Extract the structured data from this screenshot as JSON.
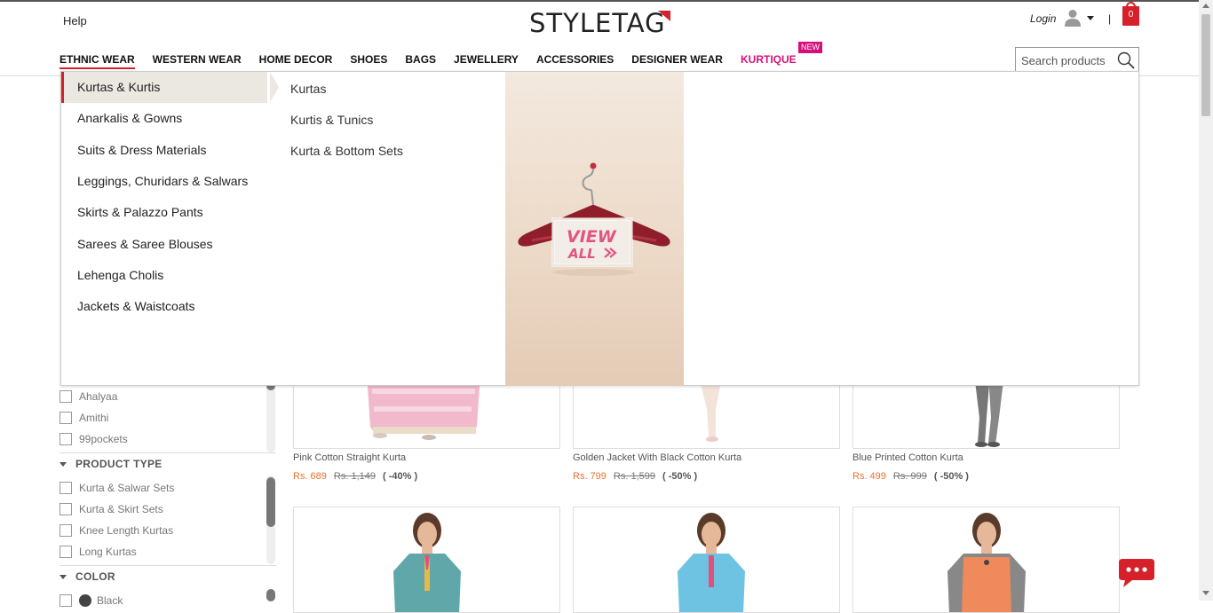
{
  "header": {
    "help": "Help",
    "logo": "STYLETAG",
    "login": "Login",
    "pipe": "|",
    "cart_count": "0",
    "search_placeholder": "Search products"
  },
  "nav": {
    "items": [
      {
        "label": "ETHNIC WEAR"
      },
      {
        "label": "WESTERN WEAR"
      },
      {
        "label": "HOME DECOR"
      },
      {
        "label": "SHOES"
      },
      {
        "label": "BAGS"
      },
      {
        "label": "JEWELLERY"
      },
      {
        "label": "ACCESSORIES"
      },
      {
        "label": "DESIGNER WEAR"
      },
      {
        "label": "KURTIQUE"
      }
    ],
    "new_badge": "NEW"
  },
  "mega_menu": {
    "categories": [
      "Kurtas & Kurtis",
      "Anarkalis & Gowns",
      "Suits & Dress Materials",
      "Leggings, Churidars & Salwars",
      "Skirts & Palazzo Pants",
      "Sarees & Saree Blouses",
      "Lehenga Cholis",
      "Jackets & Waistcoats"
    ],
    "subcategories": [
      "Kurtas",
      "Kurtis & Tunics",
      "Kurta & Bottom Sets"
    ],
    "promo_line1": "VIEW",
    "promo_line2": "ALL"
  },
  "filters": {
    "brands": [
      "Ahalyaa",
      "Amithi",
      "99pockets"
    ],
    "product_type_title": "PRODUCT TYPE",
    "product_types": [
      "Kurta & Salwar Sets",
      "Kurta & Skirt Sets",
      "Knee Length Kurtas",
      "Long Kurtas"
    ],
    "color_title": "COLOR",
    "colors": [
      "Black"
    ]
  },
  "products": [
    {
      "name": "Pink Cotton Straight Kurta",
      "price": "Rs. 689",
      "mrp": "Rs. 1,149",
      "discount": "( -40% )"
    },
    {
      "name": "Golden Jacket With Black Cotton Kurta",
      "price": "Rs. 799",
      "mrp": "Rs. 1,599",
      "discount": "( -50% )"
    },
    {
      "name": "Blue Printed Cotton Kurta",
      "price": "Rs. 499",
      "mrp": "Rs. 999",
      "discount": "( -50% )"
    }
  ],
  "colors": {
    "accent_red": "#d6202a",
    "kurtique_pink": "#d6107a",
    "price_orange": "#e8722b"
  }
}
